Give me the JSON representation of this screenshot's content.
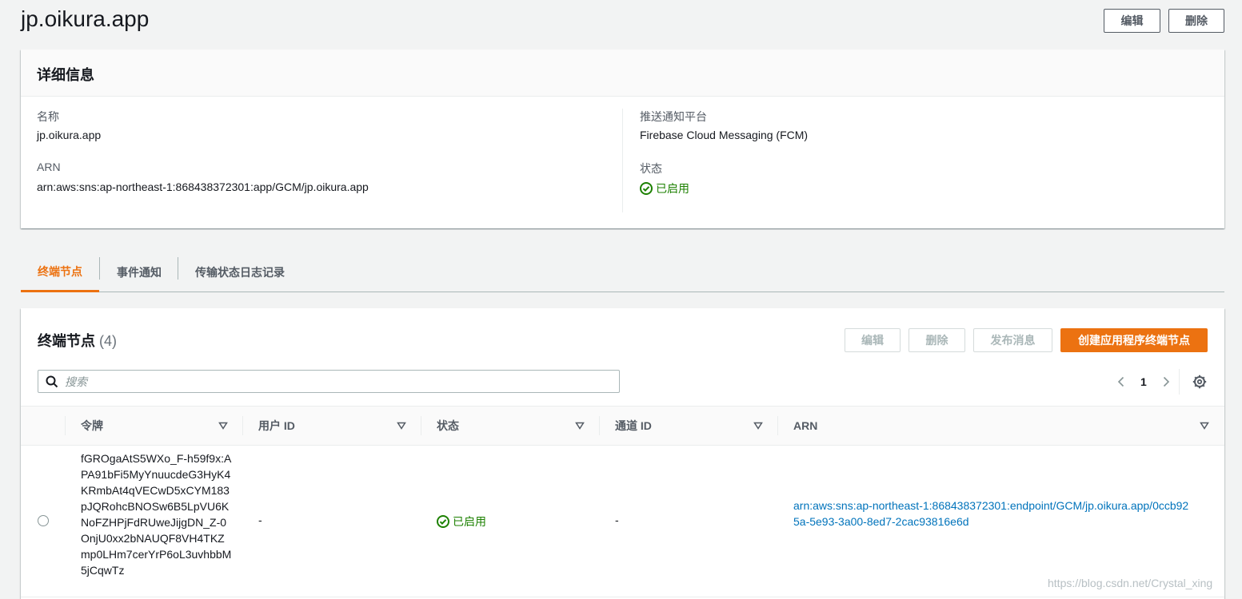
{
  "header": {
    "title": "jp.oikura.app",
    "edit_label": "编辑",
    "delete_label": "删除"
  },
  "details": {
    "title": "详细信息",
    "name_key": "名称",
    "name_value": "jp.oikura.app",
    "arn_key": "ARN",
    "arn_value": "arn:aws:sns:ap-northeast-1:868438372301:app/GCM/jp.oikura.app",
    "platform_key": "推送通知平台",
    "platform_value": "Firebase Cloud Messaging (FCM)",
    "status_key": "状态",
    "status_value": "已启用"
  },
  "tabs": [
    {
      "label": "终端节点",
      "active": true
    },
    {
      "label": "事件通知",
      "active": false
    },
    {
      "label": "传输状态日志记录",
      "active": false
    }
  ],
  "endpoints": {
    "title": "终端节点",
    "count": "(4)",
    "edit_label": "编辑",
    "delete_label": "删除",
    "publish_label": "发布消息",
    "create_label": "创建应用程序终端节点",
    "search_placeholder": "搜索",
    "page": "1",
    "columns": [
      "令牌",
      "用户 ID",
      "状态",
      "通道 ID",
      "ARN"
    ],
    "rows": [
      {
        "token": "fGROgaAtS5WXo_F-h59f9x:APA91bFi5MyYnuucdeG3HyK4KRmbAt4qVECwD5xCYM183pJQRohcBNOSw6B5LpVU6KNoFZHPjFdRUweJijgDN_Z-0OnjU0xx2bNAUQF8VH4TKZmp0LHm7cerYrP6oL3uvhbbM5jCqwTz",
        "user_id": "-",
        "status": "已启用",
        "channel_id": "-",
        "arn": "arn:aws:sns:ap-northeast-1:868438372301:endpoint/GCM/jp.oikura.app/0ccb925a-5e93-3a00-8ed7-2cac93816e6d"
      }
    ]
  },
  "watermark": "https://blog.csdn.net/Crystal_xing",
  "colors": {
    "accent": "#ec7211",
    "success": "#1d8102",
    "link": "#0073bb"
  }
}
